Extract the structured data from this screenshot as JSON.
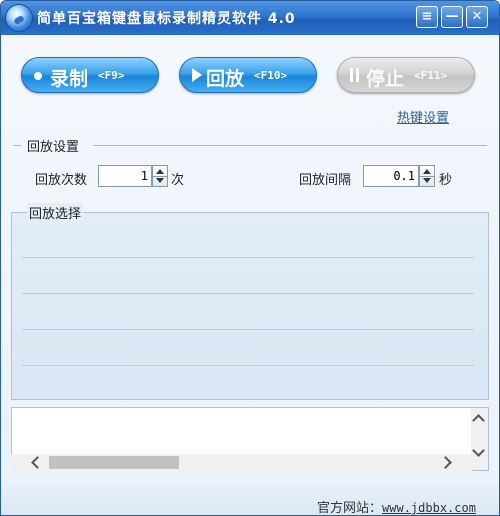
{
  "window": {
    "title": "简单百宝箱键盘鼠标录制精灵软件 4.0",
    "menu_btn": "≡",
    "min_btn": "—",
    "close_btn": "✕"
  },
  "toolbar": {
    "record_label": "录制",
    "record_key": "<F9>",
    "play_label": "回放",
    "play_key": "<F10>",
    "stop_label": "停止",
    "stop_key": "<F11>",
    "hotkey_link": "热键设置"
  },
  "playback_settings": {
    "group_title": "回放设置",
    "count_label": "回放次数",
    "count_value": "1",
    "count_unit": "次",
    "interval_label": "回放间隔",
    "interval_value": "0.1",
    "interval_unit": "秒"
  },
  "playback_select": {
    "group_title": "回放选择"
  },
  "footer": {
    "site_label": "官方网站：",
    "site_url": "www.jdbbx.com"
  },
  "colors": {
    "titlebar": "#2f74cf",
    "button_blue": "#1a86dc",
    "button_disabled": "#c4c4c4",
    "link": "#2b5d9b"
  }
}
